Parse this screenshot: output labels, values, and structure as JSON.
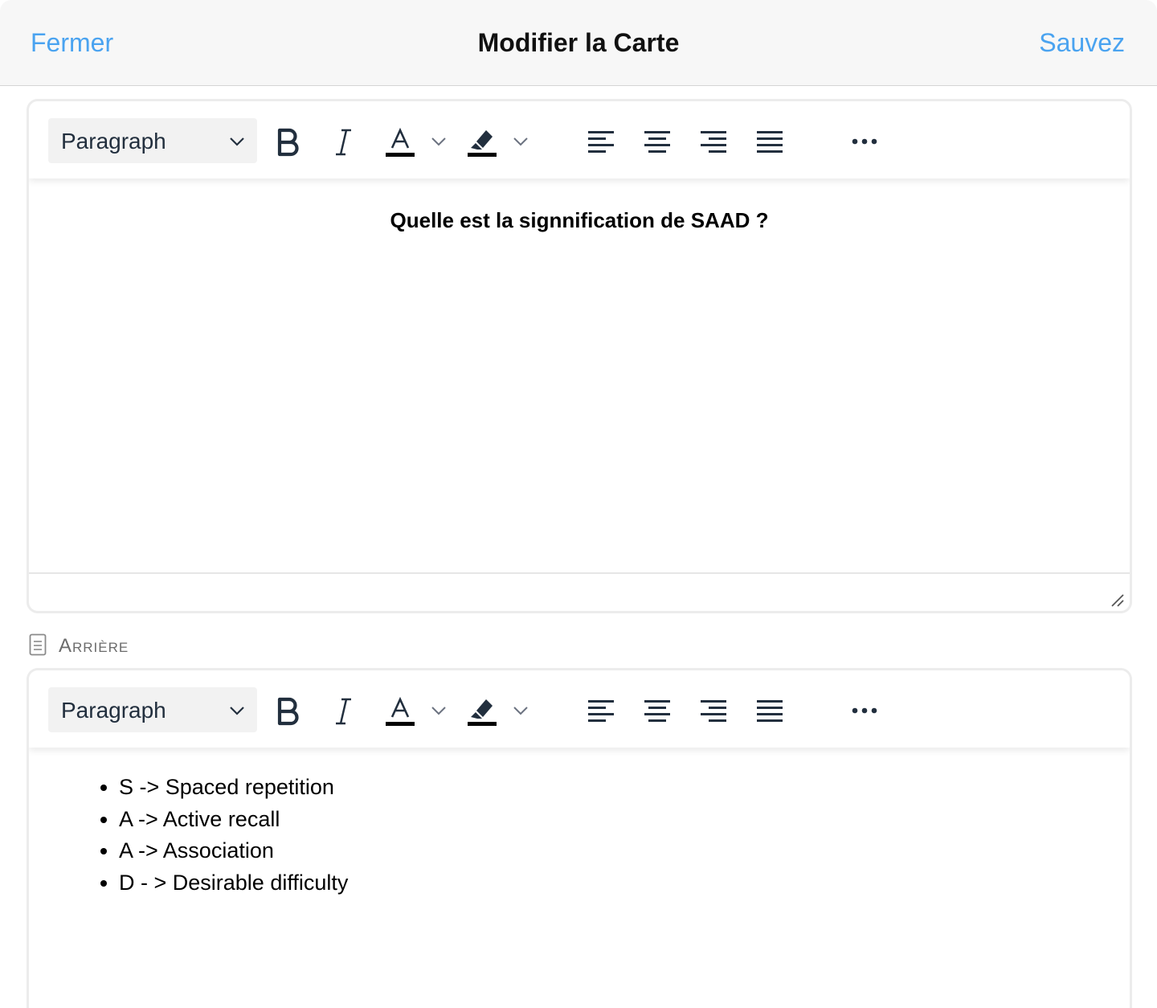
{
  "header": {
    "close_label": "Fermer",
    "title": "Modifier la Carte",
    "save_label": "Sauvez"
  },
  "front_editor": {
    "block_format": "Paragraph",
    "content": "Quelle est la signnification de SAAD ?"
  },
  "back_section": {
    "label": "Arrière"
  },
  "back_editor": {
    "block_format": "Paragraph",
    "items": [
      "S -> Spaced repetition",
      "A -> Active recall",
      "A -> Association",
      "D - > Desirable difficulty"
    ]
  },
  "toolbar_icons": [
    "bold-icon",
    "italic-icon",
    "text-color-icon",
    "highlight-icon",
    "align-left-icon",
    "align-center-icon",
    "align-right-icon",
    "align-justify-icon",
    "more-icon"
  ],
  "colors": {
    "accent": "#4aa3f0",
    "toolbar_icon": "#222f3e"
  }
}
